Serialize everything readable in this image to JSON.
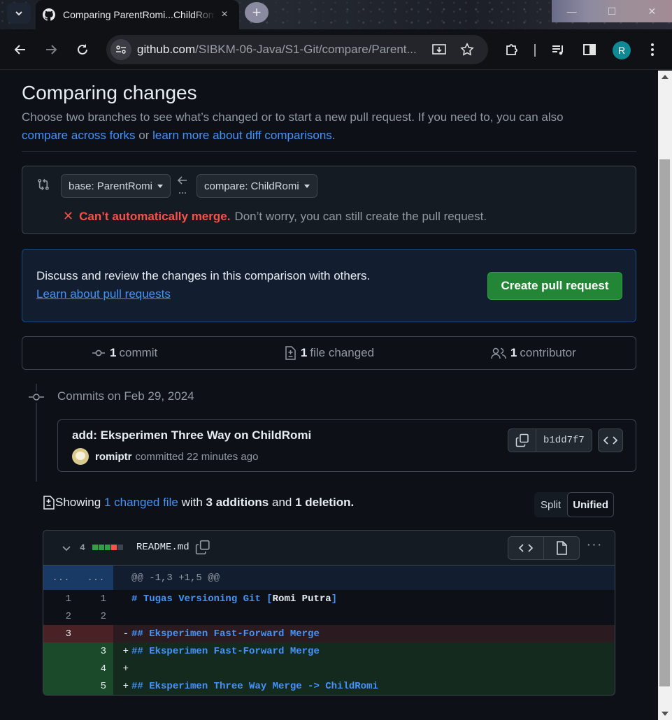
{
  "browser": {
    "tab_title": "Comparing ParentRomi...ChildRomi",
    "new_tab_label": "+",
    "close_tab": "×",
    "url_host": "github.com",
    "url_path": "/SIBKM-06-Java/S1-Git/compare/Parent...",
    "profile_initial": "R",
    "window_controls": [
      "—",
      "☐",
      "✕"
    ]
  },
  "page": {
    "heading": "Comparing changes",
    "intro_text": "Choose two branches to see what’s changed or to start a new pull request. If you need to, you can also",
    "compare_forks_link": "compare across forks",
    "or_text": "or",
    "learn_diff_link": "learn more about diff comparisons",
    "period": "."
  },
  "range": {
    "base_prefix": "base:",
    "base_branch": "ParentRomi",
    "compare_prefix": "compare:",
    "compare_branch": "ChildRomi",
    "merge_error": "Can’t automatically merge.",
    "merge_hint": "Don’t worry, you can still create the pull request."
  },
  "discuss": {
    "text": "Discuss and review the changes in this comparison with others.",
    "learn_link": "Learn about pull requests",
    "create_button": "Create pull request"
  },
  "summary": {
    "commits_count": "1",
    "commits_label": "commit",
    "files_count": "1",
    "files_label": "file changed",
    "contributors_count": "1",
    "contributors_label": "contributor"
  },
  "commits": {
    "date_header": "Commits on Feb 29, 2024",
    "title": "add: Eksperimen Three Way on ChildRomi",
    "author": "romiptr",
    "action": "committed 22 minutes ago",
    "sha": "b1dd7f7"
  },
  "diff_summary": {
    "showing": "Showing",
    "changed_file_link": "1 changed file",
    "with": "with",
    "additions": "3 additions",
    "and": "and",
    "deletions": "1 deletion",
    "period": ".",
    "split_label": "Split",
    "unified_label": "Unified"
  },
  "file": {
    "change_count": "4",
    "diffstat_colors": [
      "#2ea043",
      "#2ea043",
      "#2ea043",
      "#f85149",
      "#3d444d"
    ],
    "filename": "README.md",
    "hunk_left": "...",
    "hunk_right": "...",
    "hunk_header": "@@ -1,3 +1,5 @@",
    "lines": [
      {
        "type": "ctx",
        "old": "1",
        "new": "1",
        "sign": "",
        "prefix": "# ",
        "text": "Tugas Versioning Git [",
        "link": "Romi Putra",
        "suffix": "]"
      },
      {
        "type": "ctx",
        "old": "2",
        "new": "2",
        "sign": "",
        "prefix": "",
        "text": "",
        "link": "",
        "suffix": ""
      },
      {
        "type": "del",
        "old": "3",
        "new": "",
        "sign": "-",
        "prefix": "## ",
        "text": "Eksperimen Fast-Forward Merge",
        "link": "",
        "suffix": ""
      },
      {
        "type": "add",
        "old": "",
        "new": "3",
        "sign": "+",
        "prefix": "## ",
        "text": "Eksperimen Fast-Forward Merge",
        "link": "",
        "suffix": ""
      },
      {
        "type": "add",
        "old": "",
        "new": "4",
        "sign": "+",
        "prefix": "",
        "text": "",
        "link": "",
        "suffix": ""
      },
      {
        "type": "add",
        "old": "",
        "new": "5",
        "sign": "+",
        "prefix": "## ",
        "text": "Eksperimen Three Way Merge -> ChildRomi",
        "link": "",
        "suffix": ""
      }
    ]
  }
}
